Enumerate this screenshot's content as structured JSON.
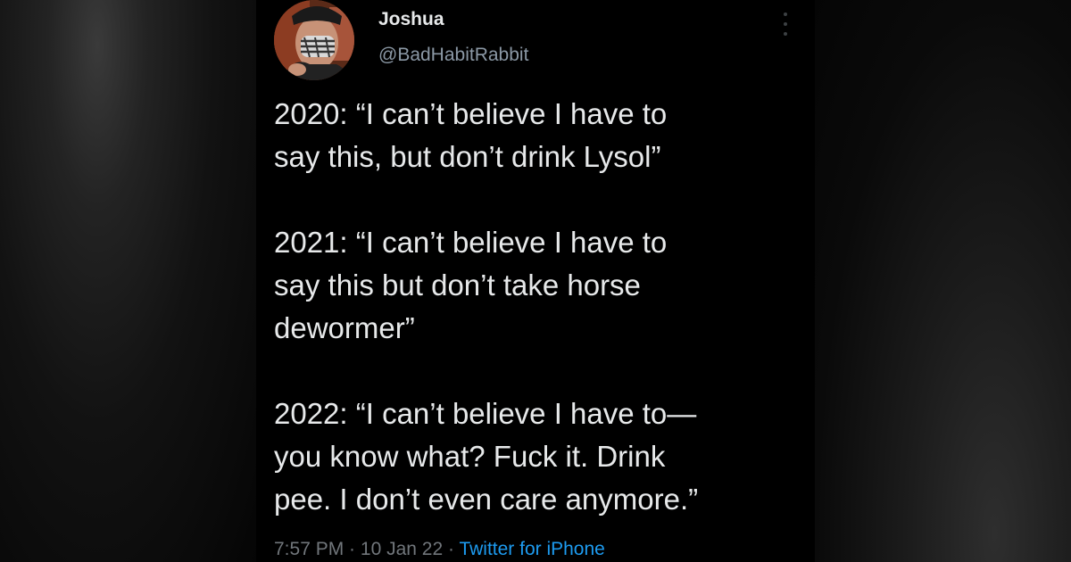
{
  "tweet": {
    "author": {
      "name": "Joshua",
      "handle": "@BadHabitRabbit"
    },
    "paragraphs": [
      "2020: “I can’t believe I have to\nsay this, but don’t drink Lysol”",
      "2021: “I can’t believe I have to\nsay this but don’t take horse\ndewormer”",
      "2022: “I can’t believe I have to—\nyou know what? Fuck it. Drink\npee. I don’t even care anymore.”"
    ],
    "meta": {
      "time": "7:57 PM",
      "date": "10 Jan 22",
      "separator": " · ",
      "source": "Twitter for iPhone"
    }
  },
  "colors": {
    "background": "#000000",
    "text": "#e7e9ea",
    "secondary_text": "#71767b",
    "link": "#1d9bf0"
  },
  "icons": {
    "more": "more-vertical-icon"
  }
}
